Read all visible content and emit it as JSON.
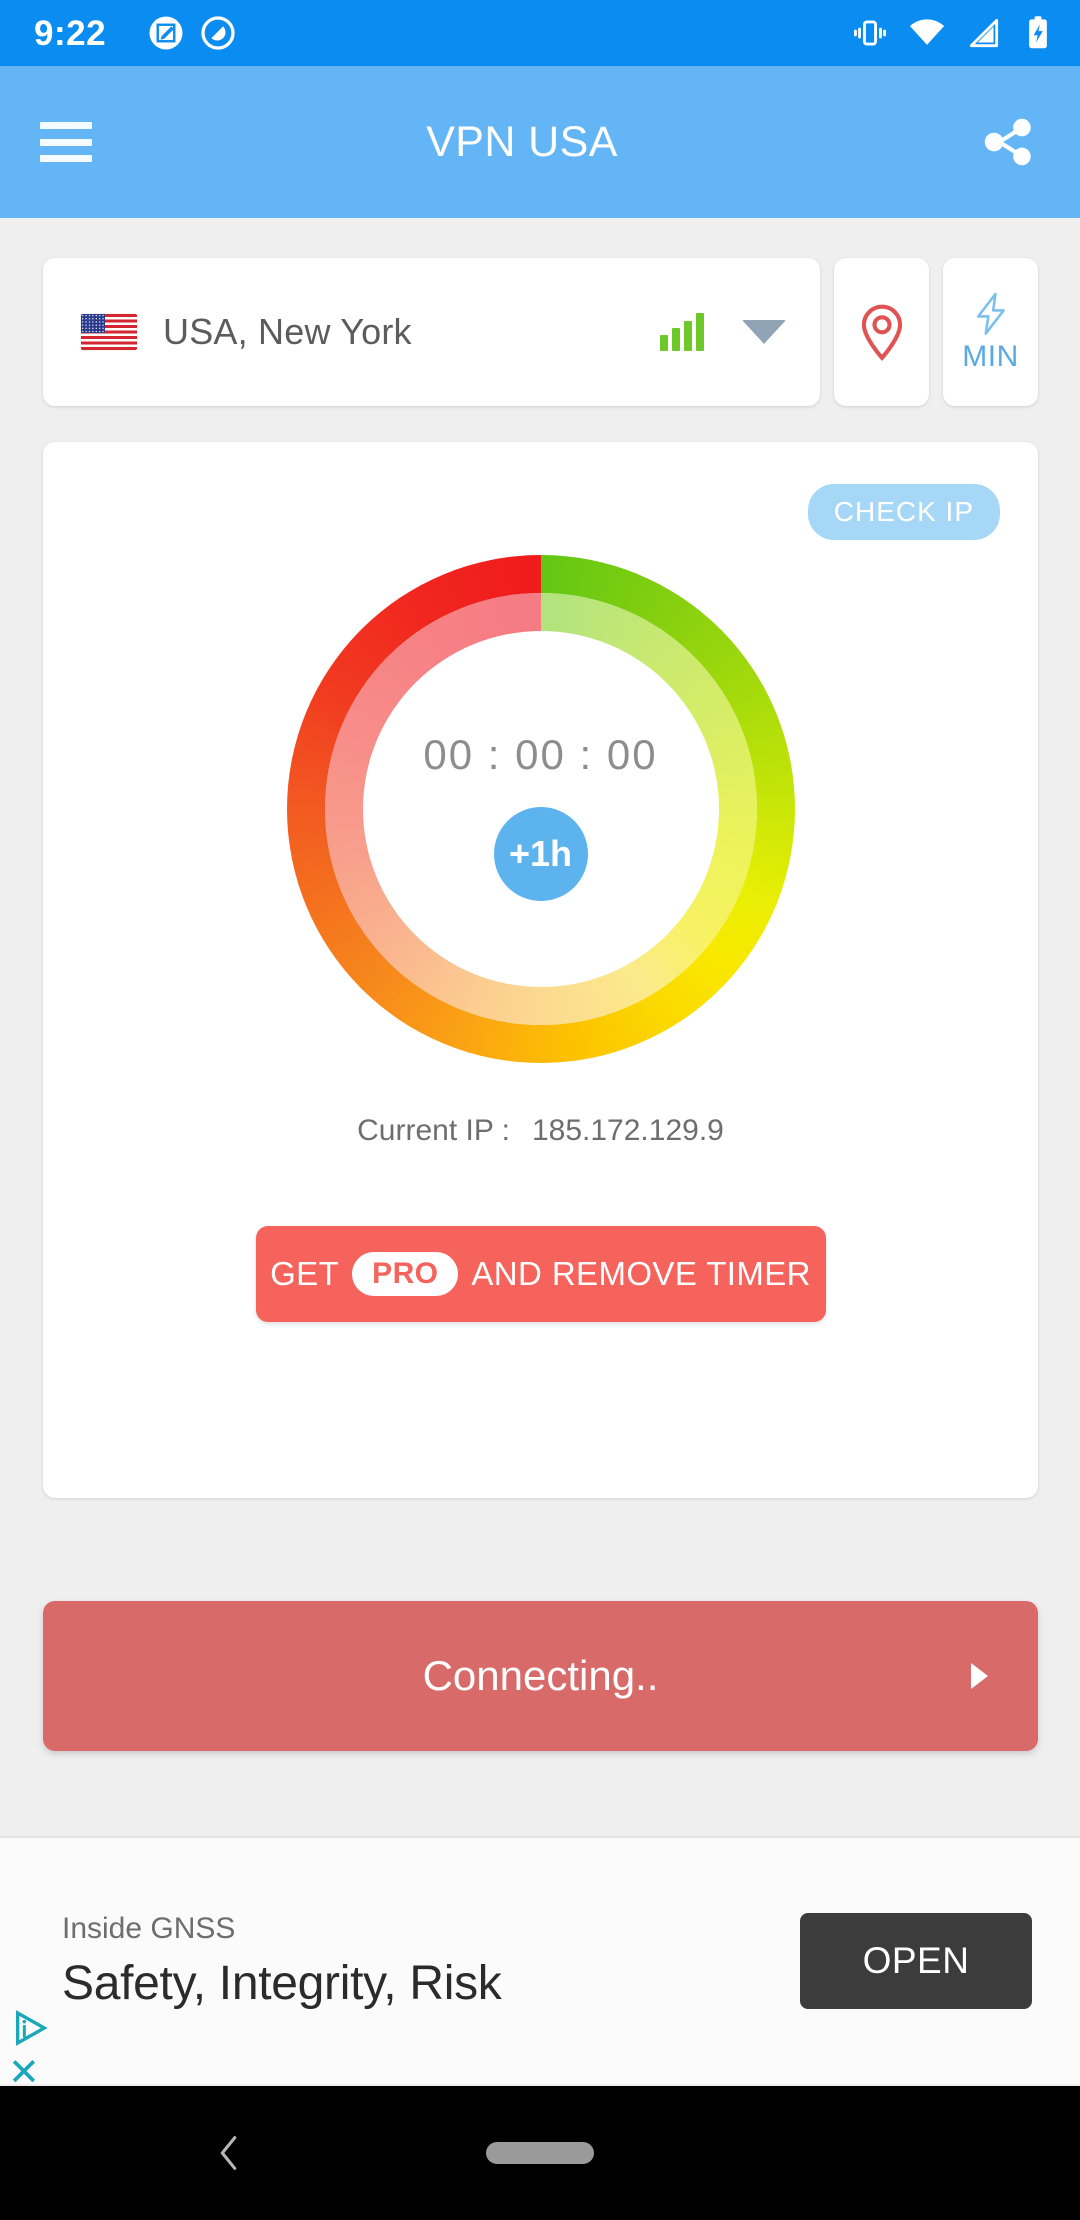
{
  "status_bar": {
    "time": "9:22",
    "left_icons": [
      "screenshot-edit-icon",
      "do-not-disturb-icon"
    ],
    "right_icons": [
      "vibrate-icon",
      "wifi-icon",
      "cellular-signal-icon",
      "battery-charging-icon"
    ]
  },
  "app_bar": {
    "menu_icon": "hamburger-menu-icon",
    "title": "VPN USA",
    "share_icon": "share-icon",
    "background_color": "#64b5f6"
  },
  "server_selector": {
    "flag": "us-flag-icon",
    "name": "USA, New York",
    "signal_icon": "signal-bars-icon",
    "signal_bars": 4,
    "signal_color": "#6fc82a",
    "dropdown_icon": "chevron-down-icon",
    "location_button": {
      "icon": "location-pin-icon",
      "color": "#df5353"
    },
    "speed_button": {
      "icon": "lightning-bolt-icon",
      "label": "MIN",
      "color": "#5aa9e6"
    }
  },
  "main_card": {
    "check_ip_label": "CHECK IP",
    "check_ip_bg": "#a7d7f7",
    "timer": "00 : 00 : 00",
    "add_hour_label": "+1h",
    "add_hour_color": "#5cb3ee",
    "current_ip_label": "Current IP :",
    "current_ip_value": "185.172.129.9",
    "pro_button": {
      "prefix": "GET",
      "badge": "PRO",
      "suffix": "AND REMOVE TIMER",
      "color": "#f6635c"
    }
  },
  "connect": {
    "label": "Connecting..",
    "arrow_icon": "play-arrow-icon",
    "color": "#d96a6a"
  },
  "ad": {
    "advertiser": "Inside GNSS",
    "headline": "Safety, Integrity, Risk",
    "cta_label": "OPEN",
    "cta_color": "#3c3c3c",
    "adchoices_icon": "adchoices-icon",
    "close_icon": "close-icon"
  },
  "nav_bar": {
    "back_icon": "back-chevron-icon",
    "home_icon": "home-pill-icon"
  }
}
